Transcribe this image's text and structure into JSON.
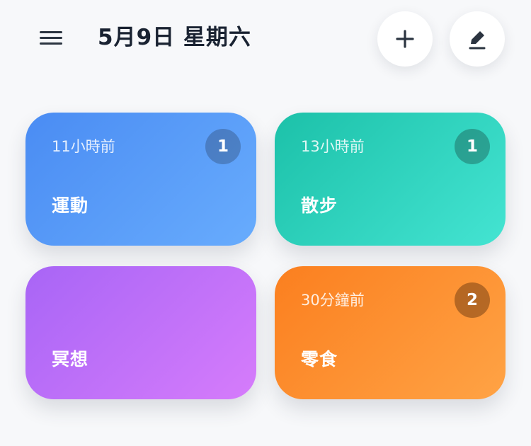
{
  "header": {
    "date_title": "5月9日 星期六",
    "menu_icon": "hamburger-menu-icon",
    "add_icon": "plus-icon",
    "edit_icon": "pencil-icon"
  },
  "cards": [
    {
      "name": "運動",
      "time_ago": "11小時前",
      "count": "1",
      "color": "#4a8cf3"
    },
    {
      "name": "散步",
      "time_ago": "13小時前",
      "count": "1",
      "color": "#1cc1a9"
    },
    {
      "name": "冥想",
      "time_ago": "",
      "count": "",
      "color": "#b56af8"
    },
    {
      "name": "零食",
      "time_ago": "30分鐘前",
      "count": "2",
      "color": "#fb8a2a"
    }
  ]
}
